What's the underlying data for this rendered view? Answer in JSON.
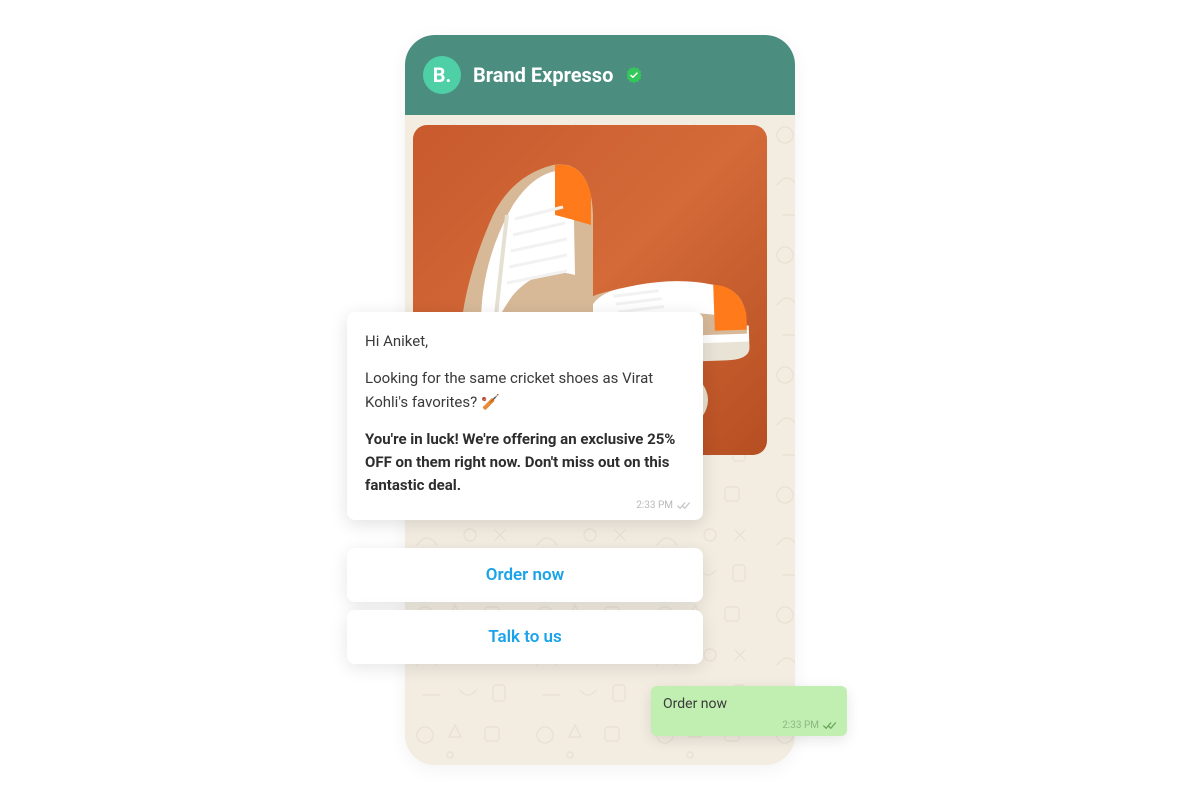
{
  "header": {
    "avatar_initial": "B.",
    "brand_name": "Brand Expresso"
  },
  "message": {
    "greeting": "Hi Aniket,",
    "line2_a": "Looking for the same cricket shoes as Virat Kohli's favorites? ",
    "line2_emoji": "🏏",
    "bold_text": "You're in luck! We're offering an exclusive 25% OFF on them right now. Don't miss out on this fantastic deal.",
    "timestamp": "2:33 PM"
  },
  "buttons": {
    "order": "Order now",
    "talk": "Talk to us"
  },
  "reply": {
    "text": "Order now",
    "timestamp": "2:33 PM"
  }
}
